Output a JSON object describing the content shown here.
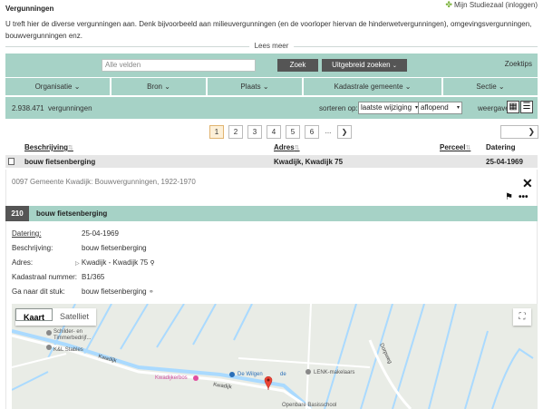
{
  "header": {
    "title": "Vergunningen",
    "login_label": "Mijn Studiezaal (inloggen)",
    "intro": "U treft hier de diverse vergunningen aan. Denk bijvoorbeeld aan milieuvergunningen (en de voorloper hiervan de hinderwetvergunningen), omgevingsvergunningen, bouwvergunningen enz.",
    "lees_meer": "Lees meer"
  },
  "search": {
    "placeholder": "Alle velden",
    "zoek_label": "Zoek",
    "uitgebreid_label": "Uitgebreid zoeken",
    "zoektips_label": "Zoektips"
  },
  "facets": [
    "Organisatie",
    "Bron",
    "Plaats",
    "Kadastrale gemeente",
    "Sectie"
  ],
  "results": {
    "count": "2.938.471",
    "count_label": "vergunningen",
    "sort_label": "sorteren op:",
    "sort_value": "laatste wijziging",
    "order_value": "aflopend",
    "view_label": "weergave:"
  },
  "pagination": {
    "pages": [
      "1",
      "2",
      "3",
      "4",
      "5",
      "6"
    ],
    "active": "1",
    "ellipsis": "..."
  },
  "table": {
    "columns": [
      "Beschrijving",
      "Adres",
      "Perceel",
      "Datering"
    ],
    "row": {
      "beschrijving": "bouw fietsenberging",
      "adres": "Kwadijk, Kwadijk 75",
      "perceel": "",
      "datering": "25-04-1969"
    }
  },
  "detail": {
    "source": "0097 Gemeente Kwadijk: Bouwvergunningen, 1922-1970",
    "record_number": "210",
    "record_title": "bouw fietsenberging",
    "fields": [
      {
        "label": "Datering:",
        "value": "25-04-1969"
      },
      {
        "label": "Beschrijving:",
        "value": "bouw fietsenberging"
      },
      {
        "label": "Adres:",
        "value": "Kwadijk - Kwadijk 75"
      },
      {
        "label": "Kadastraal nummer:",
        "value": "B1/365"
      },
      {
        "label": "Ga naar dit stuk:",
        "value": "bouw fietsenberging"
      }
    ]
  },
  "map": {
    "tab_kaart": "Kaart",
    "tab_satelliet": "Satelliet",
    "labels": {
      "schilder": "Schilder- en",
      "timmerbedrijf": "Timmerbedrijf...",
      "kl_stables": "K&L Stables",
      "kwadijkerbos": "Kwadijkerbos",
      "wilgen": "De Wilgen",
      "wilgen_suffix": "de",
      "lenk": "LENK-makelaars",
      "school": "Openbare Basisschool",
      "road1": "Kwadijk",
      "road2": "Kwadijk",
      "road3": "Dorpweg"
    },
    "colors": {
      "water": "#aadaff",
      "land": "#e9ece6",
      "road": "#ffffff",
      "pin": "#ea4335"
    }
  },
  "colors": {
    "band": "#a6d2c6",
    "dark_button": "#555555",
    "active_page": "#fdf0d8"
  }
}
